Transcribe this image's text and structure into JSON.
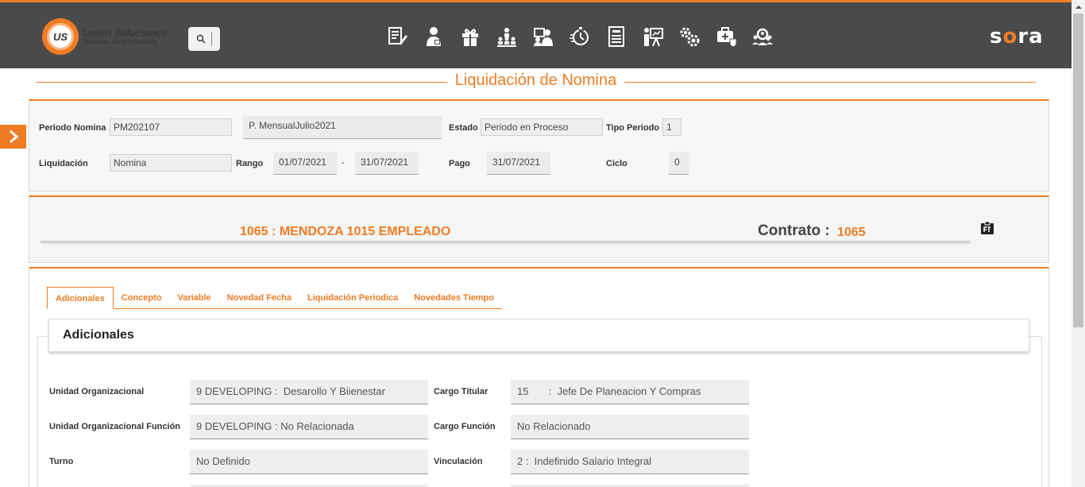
{
  "header": {
    "logo_title": "Unión Soluciones",
    "logo_subtitle": "Sistemas de Información",
    "logo_mark": "US",
    "brand_left": "s",
    "brand_mid": "o",
    "brand_right": "ra",
    "nav_icons": [
      "document-edit-icon",
      "employee-icon",
      "gift-icon",
      "org-chart-icon",
      "meeting-icon",
      "timer-icon",
      "report-list-icon",
      "presentation-icon",
      "gears-icon",
      "medical-kit-icon",
      "group-search-icon"
    ]
  },
  "page_title": "Liquidación de Nomina",
  "periodo": {
    "periodo_nomina_label": "Periodo Nomina",
    "periodo_nomina_value": "PM202107",
    "periodo_desc": "P. MensualJulio2021",
    "estado_label": "Estado",
    "estado_value": "Periodo en Proceso",
    "tipo_periodo_label": "Tipo Periodo",
    "tipo_periodo_value": "1",
    "liquidacion_label": "Liquidación",
    "liquidacion_value": "Nomina",
    "rango_label": "Rango",
    "rango_desde": "01/07/2021",
    "rango_sep": "-",
    "rango_hasta": "31/07/2021",
    "pago_label": "Pago",
    "pago_value": "31/07/2021",
    "ciclo_label": "Ciclo",
    "ciclo_value": "0"
  },
  "employee": {
    "name": "1065 : MENDOZA 1015 EMPLEADO",
    "contrato_label": "Contrato :",
    "contrato_value": "1065"
  },
  "tabs": [
    "Adicionales",
    "Concepto",
    "Variable",
    "Novedad Fecha",
    "Liquidación Periodica",
    "Novedades Tiempo"
  ],
  "section_title": "Adicionales",
  "adicionales": {
    "unidad_org_label": "Unidad Organizacional",
    "unidad_org_value": "9 DEVELOPING :  Desarollo Y Biienestar",
    "cargo_titular_label": "Cargo Titular",
    "cargo_titular_value": "15       :  Jefe De Planeacion Y Compras",
    "unidad_org_funcion_label": "Unidad Organizacional Función",
    "unidad_org_funcion_value": "9 DEVELOPING : No Relacionada",
    "cargo_funcion_label": "Cargo Función",
    "cargo_funcion_value": "No Relacionado",
    "turno_label": "Turno",
    "turno_value": "No Definido",
    "vinculacion_label": "Vinculación",
    "vinculacion_value": "2 :  Indefinido Salario Integral"
  }
}
